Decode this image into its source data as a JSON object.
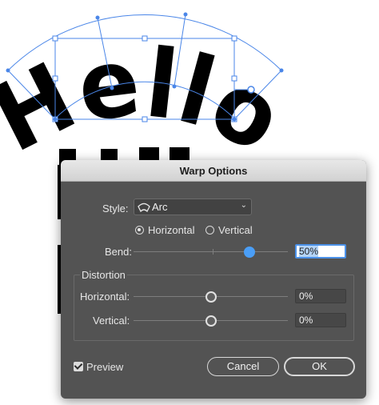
{
  "artboard": {
    "warped_text": "Hello"
  },
  "dialog": {
    "title": "Warp Options",
    "style_label": "Style:",
    "style_value": "Arc",
    "orientation": {
      "options": [
        "Horizontal",
        "Vertical"
      ],
      "selected": "Horizontal"
    },
    "bend": {
      "label": "Bend:",
      "value": "50%",
      "percent": 50
    },
    "distortion": {
      "legend": "Distortion",
      "horizontal_label": "Horizontal:",
      "horizontal_value": "0%",
      "horizontal_percent": 0,
      "vertical_label": "Vertical:",
      "vertical_value": "0%",
      "vertical_percent": 0
    },
    "preview_label": "Preview",
    "preview_checked": true,
    "cancel_label": "Cancel",
    "ok_label": "OK"
  },
  "colors": {
    "dialog_bg": "#535353",
    "accent": "#4a9ef7",
    "selection": "#4a86e8"
  }
}
